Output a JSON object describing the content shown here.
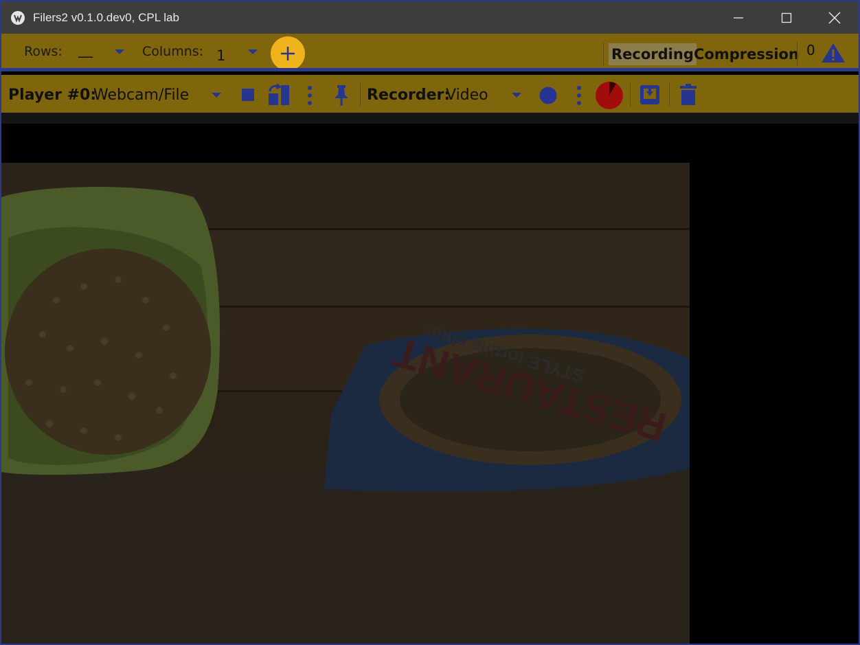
{
  "window": {
    "title": "Filers2 v0.1.0.dev0, CPL lab",
    "controls": [
      "minimize",
      "maximize",
      "close"
    ]
  },
  "top_toolbar": {
    "rows_label": "Rows:",
    "rows_value": "__",
    "columns_label": "Columns:",
    "columns_value": "1",
    "add_icon": "plus-icon",
    "recording_label": "Recording",
    "compression_label": "Compression",
    "warning_count": "0",
    "warning_icon": "warning-icon"
  },
  "player_toolbar": {
    "player_label": "Player #0:",
    "player_source": "Webcam/File",
    "recorder_label": "Recorder:",
    "recorder_type": "Video",
    "icons": [
      "stop-icon",
      "swap-source-icon",
      "more-options-icon",
      "pin-icon",
      "record-icon",
      "more-options-icon",
      "disk-usage-icon",
      "download-icon",
      "delete-icon"
    ]
  },
  "colors": {
    "toolbar_bg": "#7f650b",
    "accent_blue": "#26358f",
    "add_button": "#f0b31d",
    "record_red": "#a10d0d",
    "titlebar_bg": "#3d3d3d"
  },
  "video": {
    "bag_text_line1": "RESTAURANT",
    "bag_text_line2": "STYLE tortilla chips"
  }
}
